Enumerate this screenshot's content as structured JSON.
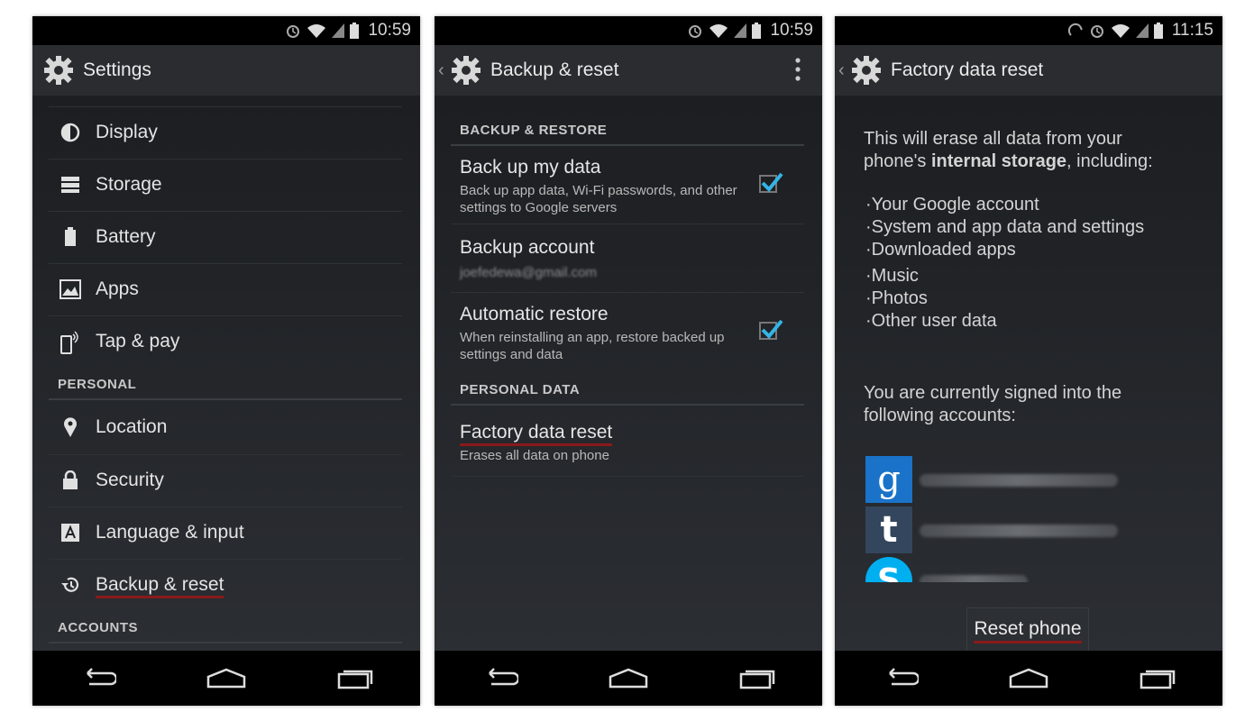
{
  "phone1": {
    "status_time": "10:59",
    "title": "Settings",
    "items_top": [
      {
        "label": "Display",
        "icon": "display-icon"
      },
      {
        "label": "Storage",
        "icon": "storage-icon"
      },
      {
        "label": "Battery",
        "icon": "battery-icon"
      },
      {
        "label": "Apps",
        "icon": "apps-icon"
      },
      {
        "label": "Tap & pay",
        "icon": "tap-pay-icon"
      }
    ],
    "section_personal": "PERSONAL",
    "items_personal": [
      {
        "label": "Location",
        "icon": "location-icon"
      },
      {
        "label": "Security",
        "icon": "lock-icon"
      },
      {
        "label": "Language & input",
        "icon": "language-icon"
      },
      {
        "label": "Backup & reset",
        "icon": "backup-icon"
      }
    ],
    "section_accounts": "ACCOUNTS"
  },
  "phone2": {
    "status_time": "10:59",
    "title": "Backup & reset",
    "section_backup": "BACKUP & RESTORE",
    "backup_my_data": {
      "title": "Back up my data",
      "summary": "Back up app data, Wi-Fi passwords, and other settings to Google servers",
      "checked": true
    },
    "backup_account": {
      "title": "Backup account",
      "summary": "joefedewa@gmail.com"
    },
    "automatic_restore": {
      "title": "Automatic restore",
      "summary": "When reinstalling an app, restore backed up settings and data",
      "checked": true
    },
    "section_personal": "PERSONAL DATA",
    "factory_reset": {
      "title": "Factory data reset",
      "summary": "Erases all data on phone"
    }
  },
  "phone3": {
    "status_time": "11:15",
    "title": "Factory data reset",
    "intro_line1": "This will erase all data from your",
    "intro_line2_pre": "phone's ",
    "intro_line2_bold": "internal storage",
    "intro_line2_post": ", including:",
    "erase_list": [
      "·Your Google account",
      "·System and app data and settings",
      "·Downloaded apps",
      "·Music",
      "·Photos",
      "·Other user data"
    ],
    "signed_in_line1": "You are currently signed into the",
    "signed_in_line2": "following accounts:",
    "accounts": [
      {
        "icon": "google-icon",
        "email": "joefedewa@gmail.com",
        "glyph": "g",
        "color": "#1a73c8"
      },
      {
        "icon": "tumblr-icon",
        "email": "joefedewa@gmail.com",
        "glyph": "t",
        "color": "#34465d"
      },
      {
        "icon": "skype-icon",
        "email": "",
        "glyph": "S",
        "color": "#00aff0"
      }
    ],
    "reset_button": "Reset phone"
  }
}
